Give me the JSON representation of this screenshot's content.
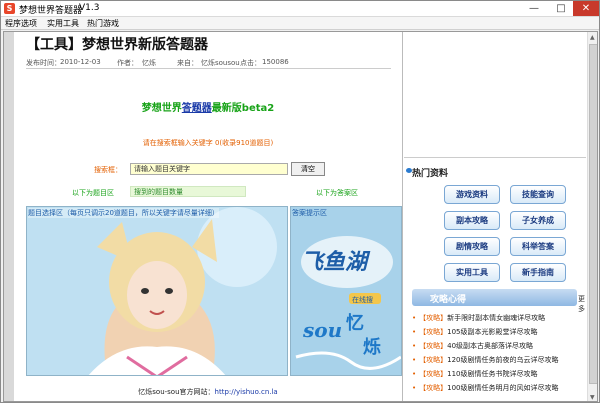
{
  "window": {
    "title": "梦想世界答题器",
    "version": "V1.3",
    "min": "—",
    "max": "□",
    "close": "✕"
  },
  "menu": [
    "程序选项",
    "实用工具",
    "热门游戏"
  ],
  "article": {
    "title": "【工具】梦想世界新版答题器",
    "publish_label": "发布时间：",
    "publish_date": "2010-12-03",
    "author_label": "作者：",
    "author": "忆烁",
    "source_label": "来自：",
    "source": "忆烁sousou",
    "clicks_label": "点击：",
    "clicks": "150086"
  },
  "tool": {
    "name_prefix": "梦想世界",
    "name_link": "答题器",
    "name_suffix": "最新版beta2",
    "hint": "请在搜索框输入关键字 0(收录910道题目)",
    "search_label": "搜索框：",
    "search_value": "请输入题目关键字",
    "clear_button": "清空",
    "q_area_label": "以下为题目区",
    "q_count": "搜到的题目数量",
    "a_area_label": "以下为答案区",
    "q_panel_header": "题目选择区（每页只调示20道题目，所以关键字请尽量详细）",
    "a_panel_header": "答案提示区",
    "website_prefix": "忆烁sou-sou官方网站：",
    "website_url": "http://yishuo.cn.la"
  },
  "sidebar": {
    "hot_title": "热门资料",
    "buttons": [
      "游戏资料",
      "技能查询",
      "副本攻略",
      "子女养成",
      "剧情攻略",
      "科举答案",
      "实用工具",
      "新手指南"
    ],
    "strategy_title": "攻略心得",
    "strategy_more": "更多",
    "strategy_items": [
      {
        "tag": "【攻略】",
        "text": "新手限时副本情女幽魂详尽攻略"
      },
      {
        "tag": "【攻略】",
        "text": "105级副本光影殿堂详尽攻略"
      },
      {
        "tag": "【攻略】",
        "text": "40级副本古奥部落详尽攻略"
      },
      {
        "tag": "【攻略】",
        "text": "120级剧情任务前夜的乌云详尽攻略"
      },
      {
        "tag": "【攻略】",
        "text": "110级剧情任务书院详尽攻略"
      },
      {
        "tag": "【攻略】",
        "text": "100级剧情任务明月的风如详尽攻略"
      }
    ]
  },
  "colors": {
    "accent_green": "#18a318",
    "hint_orange": "#e35f00",
    "link_blue": "#1a3aa8"
  }
}
